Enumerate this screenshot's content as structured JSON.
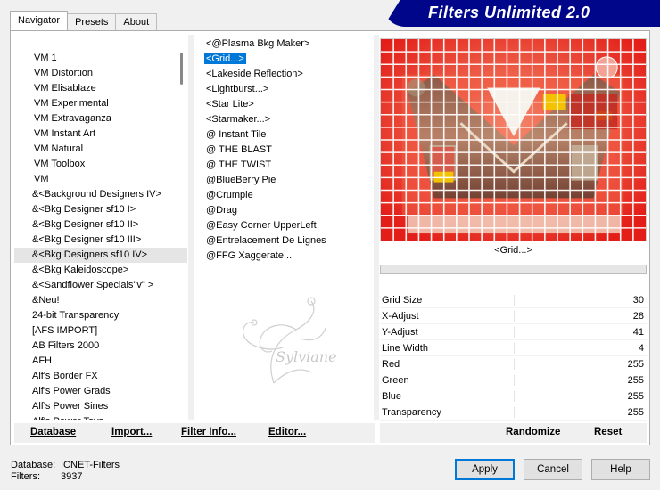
{
  "tabs": [
    "Navigator",
    "Presets",
    "About"
  ],
  "title": "Filters Unlimited 2.0",
  "categories": [
    "VM 1",
    "VM Distortion",
    "VM Elisablaze",
    "VM Experimental",
    "VM Extravaganza",
    "VM Instant Art",
    "VM Natural",
    "VM Toolbox",
    "VM",
    "&<Background Designers IV>",
    "&<Bkg Designer sf10 I>",
    "&<Bkg Designer sf10 II>",
    "&<Bkg Designer sf10 III>",
    "&<Bkg Designers sf10 IV>",
    "&<Bkg Kaleidoscope>",
    "&<Sandflower Specials\"v\" >",
    "&Neu!",
    "24-bit Transparency",
    "[AFS IMPORT]",
    "AB Filters 2000",
    "AFH",
    "Alf's Border FX",
    "Alf's Power Grads",
    "Alf's Power Sines",
    "Alf's Power Toys"
  ],
  "selected_category": "&<Bkg Designers sf10 IV>",
  "filters": [
    "<@Plasma Bkg Maker>",
    "<Grid...>",
    "<Lakeside Reflection>",
    "<Lightburst...>",
    "<Star Lite>",
    "<Starmaker...>",
    "@ Instant Tile",
    "@ THE BLAST",
    "@ THE TWIST",
    "@BlueBerry Pie",
    "@Crumple",
    "@Drag",
    "@Easy Corner UpperLeft",
    "@Entrelacement De Lignes",
    "@FFG Xaggerate..."
  ],
  "selected_filter": "<Grid...>",
  "watermark": "Sylviane",
  "preview_label": "<Grid...>",
  "params": [
    {
      "label": "Grid Size",
      "value": "30"
    },
    {
      "label": "X-Adjust",
      "value": "28"
    },
    {
      "label": "Y-Adjust",
      "value": "41"
    },
    {
      "label": "Line Width",
      "value": "4"
    },
    {
      "label": "Red",
      "value": "255"
    },
    {
      "label": "Green",
      "value": "255"
    },
    {
      "label": "Blue",
      "value": "255"
    },
    {
      "label": "Transparency",
      "value": "255"
    }
  ],
  "left_buttons": {
    "database": "Database",
    "import": "Import...",
    "filter_info": "Filter Info...",
    "editor": "Editor..."
  },
  "right_buttons": {
    "randomize": "Randomize",
    "reset": "Reset"
  },
  "footer": {
    "database_label": "Database:",
    "database_value": "ICNET-Filters",
    "filters_label": "Filters:",
    "filters_value": "3937"
  },
  "dialog_buttons": {
    "apply": "Apply",
    "cancel": "Cancel",
    "help": "Help"
  },
  "colors": {
    "banner": "#00068a",
    "selection": "#0078d7",
    "preview_red": "#e8261e"
  }
}
